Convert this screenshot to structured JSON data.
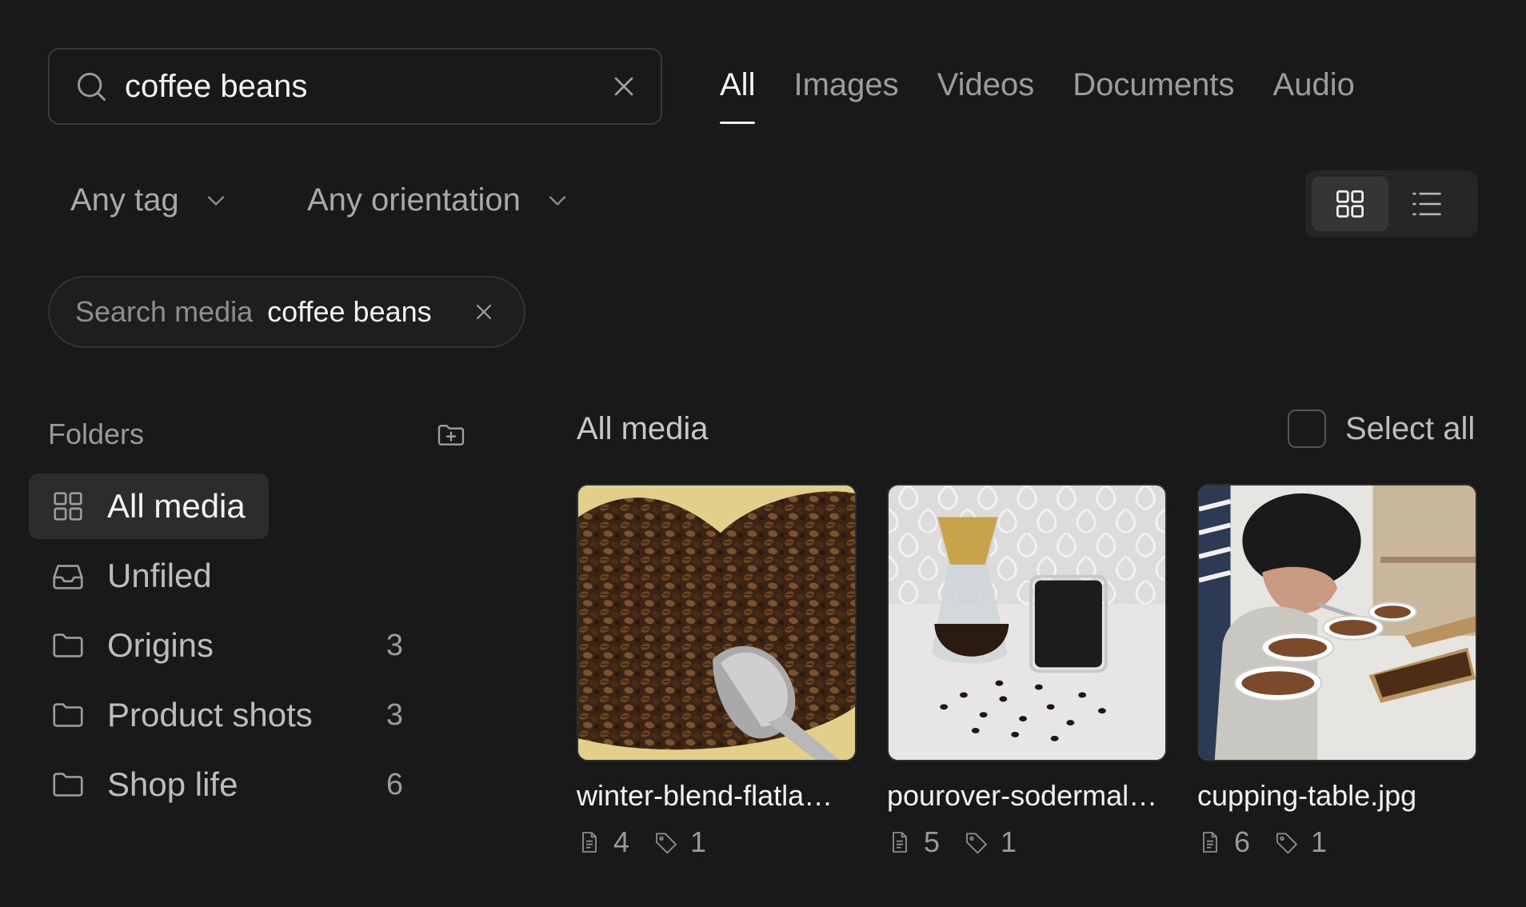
{
  "search": {
    "value": "coffee beans",
    "placeholder": "Search media"
  },
  "tabs": [
    {
      "label": "All",
      "active": true
    },
    {
      "label": "Images"
    },
    {
      "label": "Videos"
    },
    {
      "label": "Documents"
    },
    {
      "label": "Audio"
    }
  ],
  "filters": {
    "tag": "Any tag",
    "orientation": "Any orientation"
  },
  "view": {
    "mode": "grid",
    "options": [
      "grid-icon",
      "list-icon"
    ]
  },
  "chip": {
    "label": "Search media",
    "value": "coffee beans"
  },
  "sidebar": {
    "title": "Folders",
    "items": [
      {
        "label": "All media",
        "icon": "grid-icon",
        "count": "",
        "active": true
      },
      {
        "label": "Unfiled",
        "icon": "inbox-icon",
        "count": ""
      },
      {
        "label": "Origins",
        "icon": "folder-icon",
        "count": "3"
      },
      {
        "label": "Product shots",
        "icon": "folder-icon",
        "count": "3"
      },
      {
        "label": "Shop life",
        "icon": "folder-icon",
        "count": "6"
      }
    ]
  },
  "main": {
    "title": "All media",
    "select_all": "Select all",
    "items": [
      {
        "name": "winter-blend-flatla…",
        "docs": "4",
        "tags": "1",
        "thumb": "coffee-beans-scoop-photo"
      },
      {
        "name": "pourover-sodermal…",
        "docs": "5",
        "tags": "1",
        "thumb": "pourover-chemex-photo"
      },
      {
        "name": "cupping-table.jpg",
        "docs": "6",
        "tags": "1",
        "thumb": "coffee-cupping-photo"
      }
    ]
  },
  "colors": {
    "background": "#191919",
    "active_bg": "#2c2c2c",
    "text": "#f2f2f2",
    "muted": "#9a9a9a"
  }
}
